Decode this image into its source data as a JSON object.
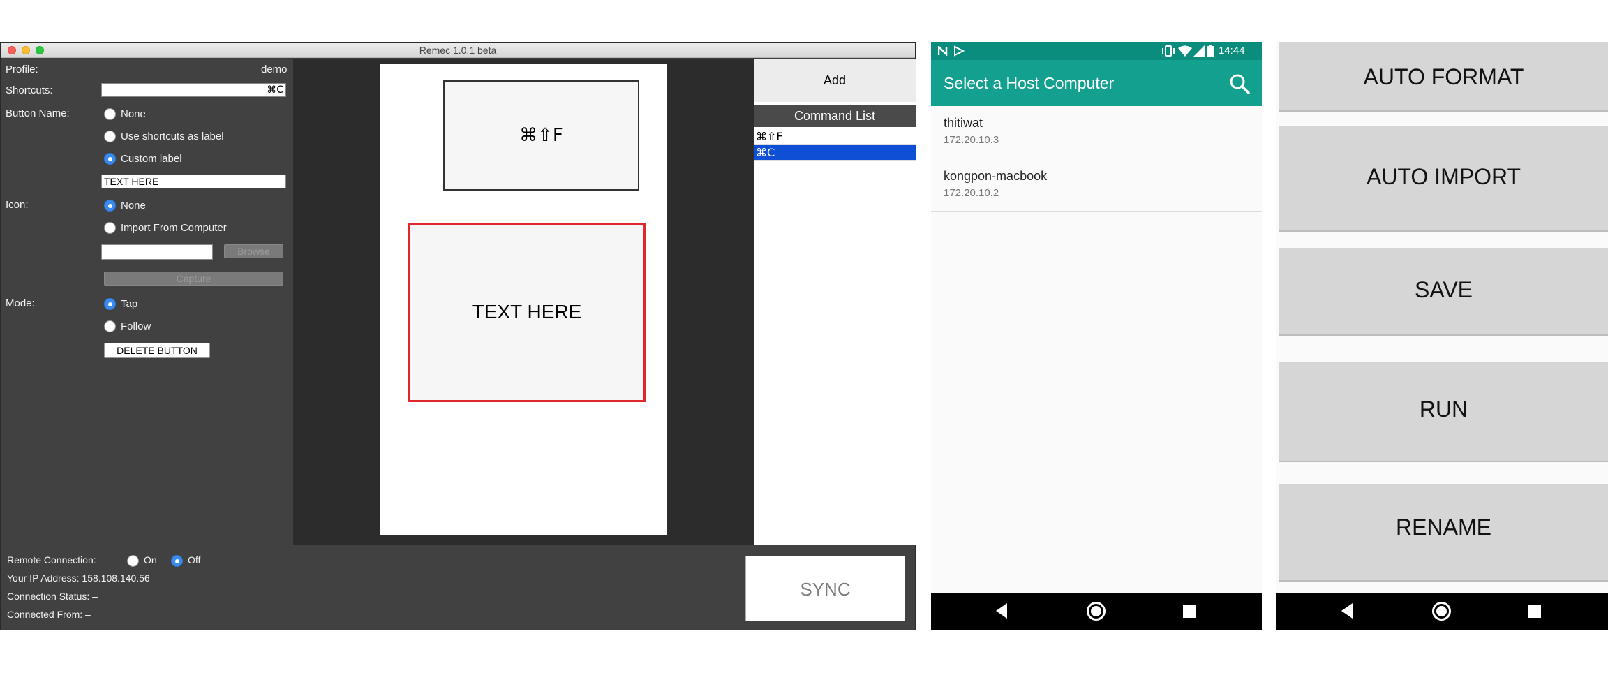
{
  "mac_window": {
    "title": "Remec 1.0.1 beta",
    "left_panel": {
      "profile_label": "Profile:",
      "profile_value": "demo",
      "shortcuts_label": "Shortcuts:",
      "shortcuts_value": "⌘C",
      "button_name_label": "Button Name:",
      "button_name_options": [
        "None",
        "Use shortcuts as label",
        "Custom label"
      ],
      "button_name_selected": "Custom label",
      "custom_label_value": "TEXT HERE",
      "icon_label": "Icon:",
      "icon_options": [
        "None",
        "Import From Computer"
      ],
      "icon_selected": "None",
      "browse_label": "Browse",
      "capture_label": "Capture",
      "mode_label": "Mode:",
      "mode_options": [
        "Tap",
        "Follow"
      ],
      "mode_selected": "Tap",
      "delete_button_label": "DELETE BUTTON"
    },
    "preview": {
      "button1_label": "⌘⇧F",
      "button2_label": "TEXT HERE"
    },
    "right_panel": {
      "add_label": "Add",
      "command_list_title": "Command List",
      "commands": [
        "⌘⇧F",
        "⌘C"
      ],
      "selected_command": "⌘C"
    },
    "bottom_panel": {
      "remote_connection_label": "Remote Connection:",
      "remote_on_label": "On",
      "remote_off_label": "Off",
      "remote_selected": "Off",
      "ip_address": "Your IP Address: 158.108.140.56",
      "connection_status": "Connection Status: –",
      "connected_from": "Connected From: –",
      "sync_label": "SYNC"
    }
  },
  "android_host_select": {
    "status_time": "14:44",
    "app_title": "Select a Host Computer",
    "hosts": [
      {
        "name": "thitiwat",
        "ip": "172.20.10.3"
      },
      {
        "name": "kongpon-macbook",
        "ip": "172.20.10.2"
      }
    ],
    "colors": {
      "app_bar": "#14a08f",
      "status_bar": "#0a8d7d"
    }
  },
  "android_remote": {
    "buttons": [
      "AUTO FORMAT",
      "AUTO IMPORT",
      "SAVE",
      "RUN",
      "RENAME"
    ]
  }
}
